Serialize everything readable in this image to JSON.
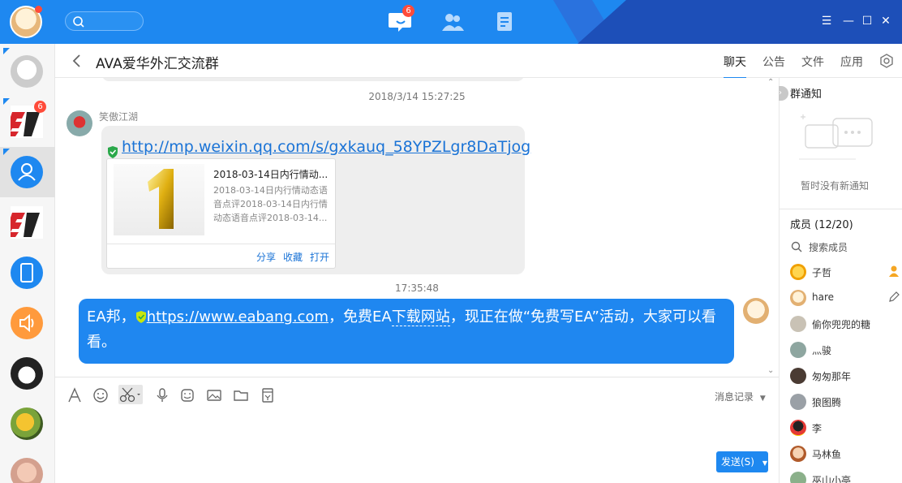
{
  "topbar": {
    "search_placeholder": "",
    "nav": [
      {
        "name": "messages",
        "badge": "6"
      },
      {
        "name": "contacts"
      },
      {
        "name": "apps"
      }
    ]
  },
  "rail": {
    "items": [
      {
        "name": "anime-character",
        "badge": ""
      },
      {
        "name": "ea-logo-red",
        "badge": "6"
      },
      {
        "name": "group-avatar",
        "badge": ""
      },
      {
        "name": "ea-logo-red-2",
        "badge": ""
      },
      {
        "name": "tablet-device",
        "badge": ""
      },
      {
        "name": "speaker",
        "badge": ""
      },
      {
        "name": "anime-boy",
        "badge": ""
      },
      {
        "name": "fruit-cake",
        "badge": ""
      },
      {
        "name": "baby-photo",
        "badge": ""
      }
    ]
  },
  "header": {
    "title": "AVA爱华外汇交流群",
    "tabs": [
      "聊天",
      "公告",
      "文件",
      "应用"
    ]
  },
  "chat": {
    "timestamp_1": "2018/3/14 15:27:25",
    "sender_name": "笑傲江湖",
    "link": "http://mp.weixin.qq.com/s/gxkauq_58YPZLgr8DaTjog",
    "card": {
      "title": "2018-03-14日内行情动...",
      "desc": "2018-03-14日内行情动态语音点评2018-03-14日内行情动态语音点评2018-03-14...",
      "actions": [
        "分享",
        "收藏",
        "打开"
      ]
    },
    "timestamp_2": "17:35:48",
    "out_message": {
      "prefix": "EA邦，",
      "link": "https://www.eabang.com",
      "mid": "，免费EA",
      "dotted": "下载网站",
      "suffix": "，现正在做“免费写EA”活动，大家可以看看。"
    }
  },
  "toolbar": {
    "history_label": "消息记录",
    "send_label": "发送(S)"
  },
  "right_panel": {
    "notice_title": "群通知",
    "notice_empty": "暂时没有新通知",
    "members_title": "成员 (12/20)",
    "member_search": "搜索成员",
    "members": [
      {
        "name": "子哲",
        "tag": "owner"
      },
      {
        "name": "hare",
        "tag": "edit"
      },
      {
        "name": "偷你兜兜的糖",
        "tag": ""
      },
      {
        "name": "灬骏",
        "tag": ""
      },
      {
        "name": "匆匆那年",
        "tag": ""
      },
      {
        "name": "狼图腾",
        "tag": ""
      },
      {
        "name": "李",
        "tag": ""
      },
      {
        "name": "马林鱼",
        "tag": ""
      },
      {
        "name": "巫山小亭",
        "tag": ""
      }
    ]
  },
  "colors": {
    "accent": "#1e88f0",
    "titlebar_dark": "#1d4fb8",
    "badge": "#ff4b3a"
  }
}
